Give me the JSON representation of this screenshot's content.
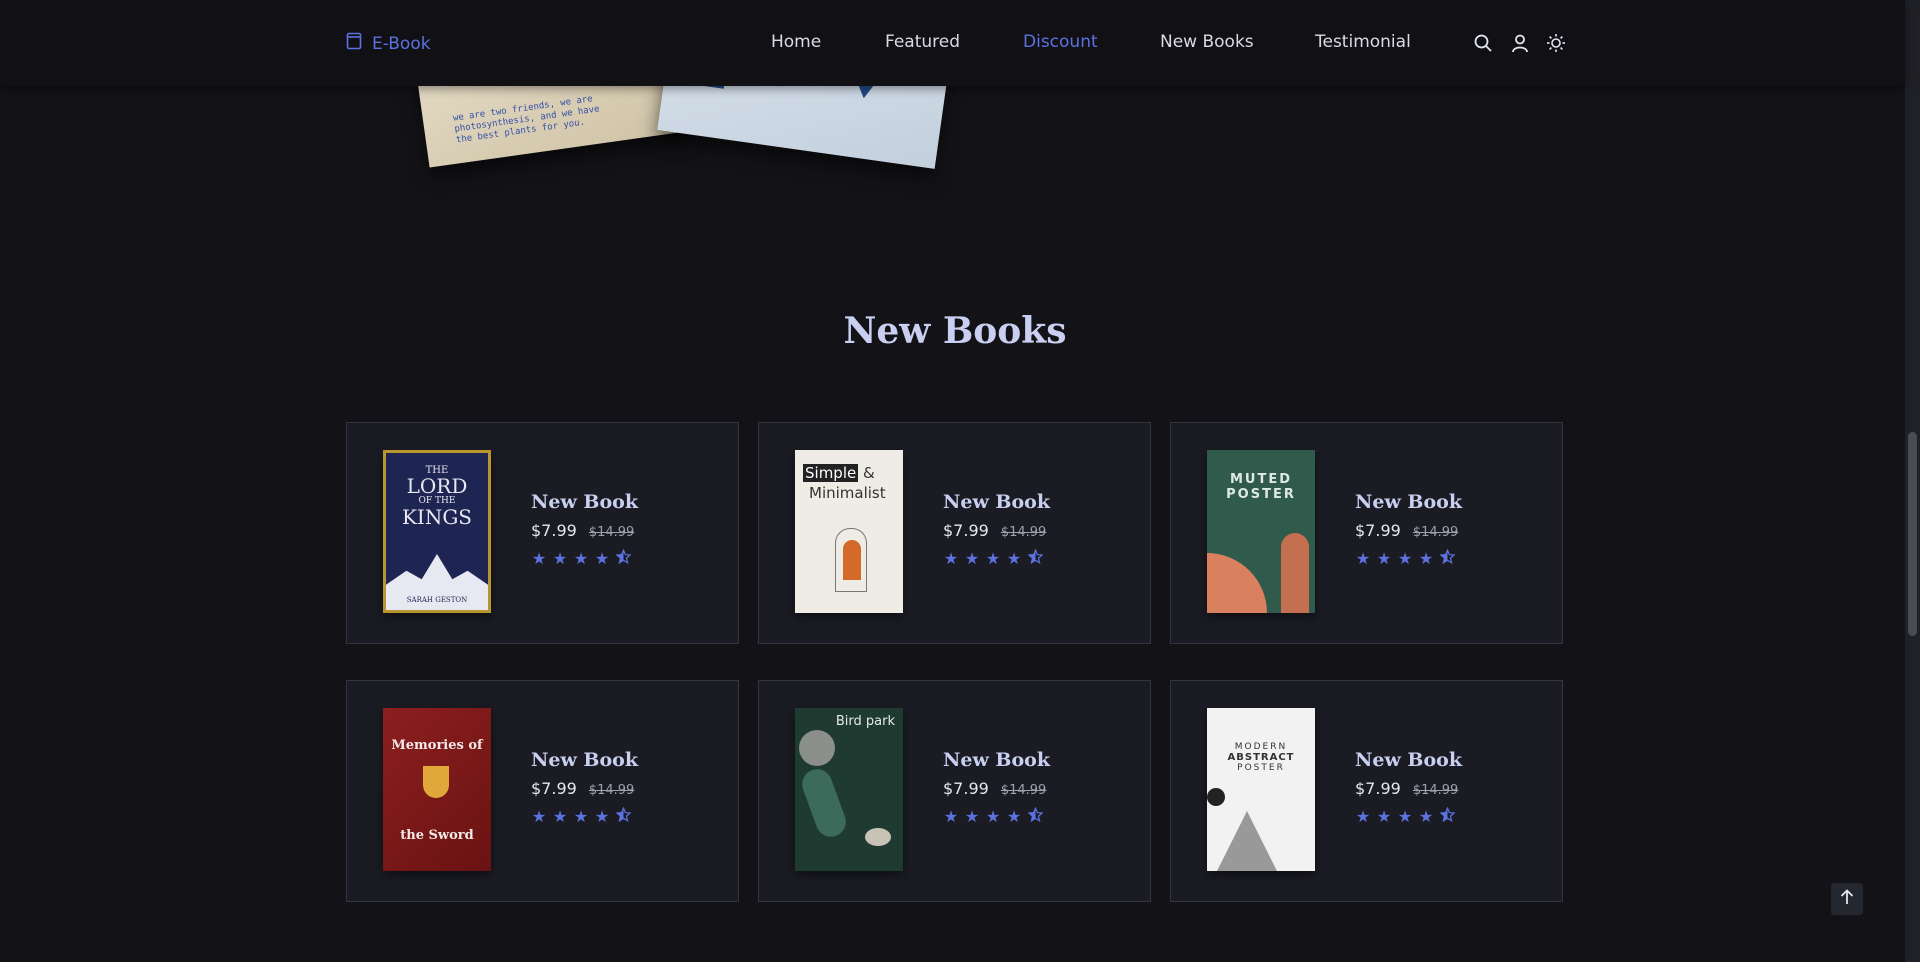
{
  "header": {
    "logo_text": "E-Book",
    "nav": [
      {
        "label": "Home",
        "active": false
      },
      {
        "label": "Featured",
        "active": false
      },
      {
        "label": "Discount",
        "active": true
      },
      {
        "label": "New Books",
        "active": false
      },
      {
        "label": "Testimonial",
        "active": false
      }
    ],
    "icons": [
      "search-icon",
      "user-icon",
      "sun-icon"
    ]
  },
  "hero": {
    "book_text": "we are two friends, we are photosynthesis, and we have the best plants for you."
  },
  "section": {
    "title": "New Books"
  },
  "books": [
    {
      "title": "New Book",
      "price": "$7.99",
      "old_price": "$14.99",
      "rating": 4.5,
      "cover": {
        "style": "lord",
        "lines": [
          "THE",
          "LORD",
          "OF THE",
          "KINGS"
        ],
        "author": "SARAH GESTON"
      }
    },
    {
      "title": "New Book",
      "price": "$7.99",
      "old_price": "$14.99",
      "rating": 4.5,
      "cover": {
        "style": "simple",
        "lines": [
          "Simple",
          "&",
          "Minimalist"
        ]
      }
    },
    {
      "title": "New Book",
      "price": "$7.99",
      "old_price": "$14.99",
      "rating": 4.5,
      "cover": {
        "style": "muted",
        "lines": [
          "MUTED",
          "POSTER"
        ]
      }
    },
    {
      "title": "New Book",
      "price": "$7.99",
      "old_price": "$14.99",
      "rating": 4.5,
      "cover": {
        "style": "sword",
        "lines": [
          "Memories of",
          "the Sword"
        ]
      }
    },
    {
      "title": "New Book",
      "price": "$7.99",
      "old_price": "$14.99",
      "rating": 4.5,
      "cover": {
        "style": "bird",
        "lines": [
          "Bird park"
        ]
      }
    },
    {
      "title": "New Book",
      "price": "$7.99",
      "old_price": "$14.99",
      "rating": 4.5,
      "cover": {
        "style": "abstract",
        "lines": [
          "MODERN",
          "ABSTRACT",
          "POSTER"
        ]
      }
    }
  ],
  "colors": {
    "accent": "#5b72e0",
    "background": "#131317",
    "card": "#1b1c23"
  }
}
